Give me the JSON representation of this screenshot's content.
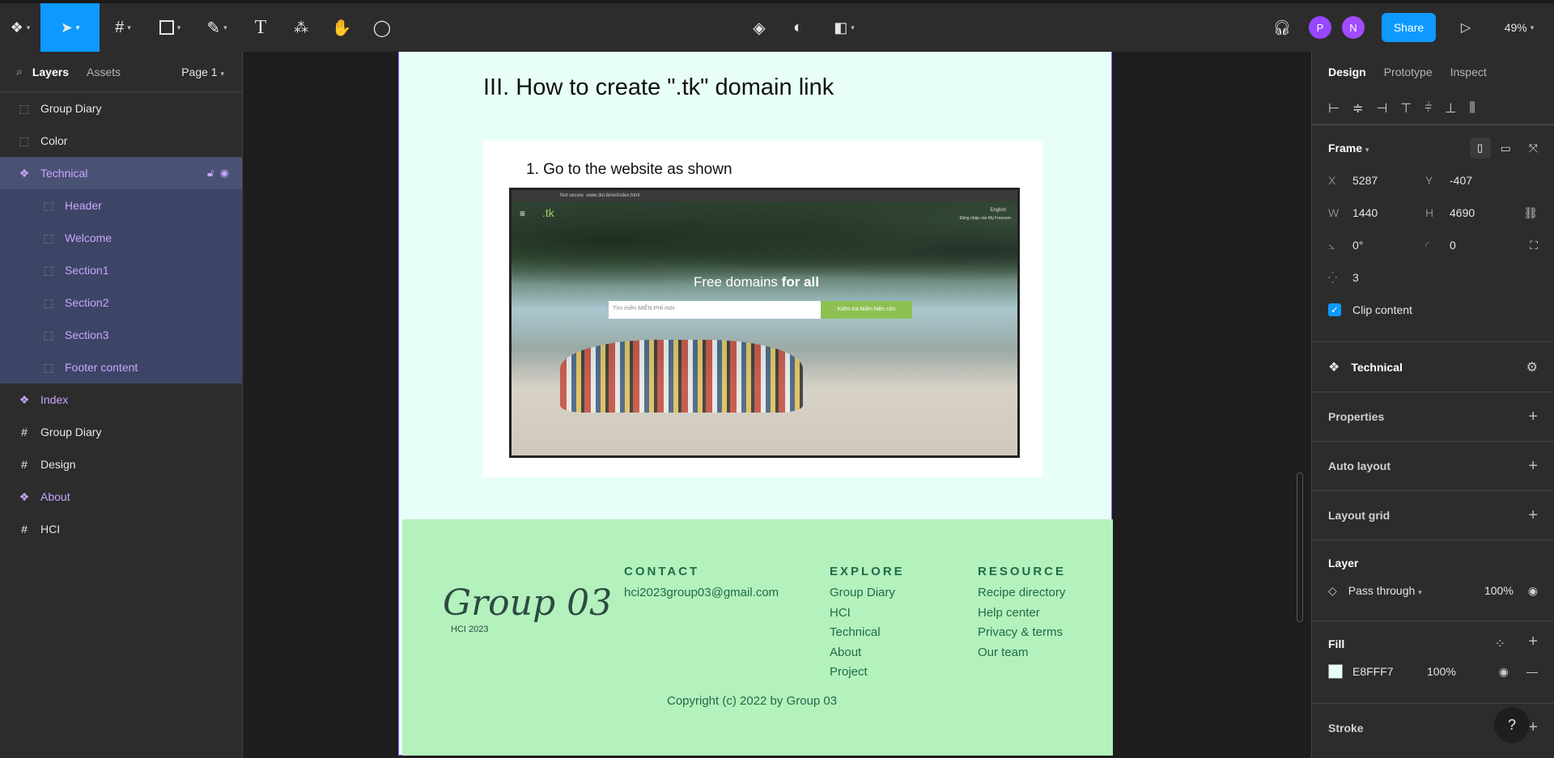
{
  "topbar": {
    "avatars": [
      "P",
      "N"
    ],
    "share_label": "Share",
    "zoom": "49%"
  },
  "left_panel": {
    "tabs": [
      "Layers",
      "Assets"
    ],
    "page_selector": "Page 1",
    "layers": [
      {
        "label": "Group Diary"
      },
      {
        "label": "Color"
      },
      {
        "label": "Technical"
      },
      {
        "label": "Header"
      },
      {
        "label": "Welcome"
      },
      {
        "label": "Section1"
      },
      {
        "label": "Section2"
      },
      {
        "label": "Section3"
      },
      {
        "label": "Footer content"
      },
      {
        "label": "Index"
      },
      {
        "label": "Group Diary"
      },
      {
        "label": "Design"
      },
      {
        "label": "About"
      },
      {
        "label": "HCI"
      }
    ]
  },
  "artboard": {
    "heading": "III. How to create \".tk\" domain link",
    "step_text": "1. Go to the website as shown",
    "screenshot": {
      "hero_text_light": "Free domains",
      "hero_text_bold": "for all",
      "search_placeholder": "Tìm miền MIỄN PHÍ mới",
      "search_button": "Kiểm tra Miền hiện còn",
      "browser_url": "www.dot.tk/vn/index.html",
      "not_secure": "Not secure",
      "lang": "English",
      "login": "Đăng nhập vào My Freenom",
      "logo": ".tk"
    },
    "footer": {
      "logo_script": "Group 03",
      "logo_sub": "HCI 2023",
      "contact_heading": "CONTACT",
      "contact_email": "hci2023group03@gmail.com",
      "explore_heading": "EXPLORE",
      "explore_links": [
        "Group Diary",
        "HCI",
        "Technical",
        "About",
        "Project"
      ],
      "resource_heading": "RESOURCE",
      "resource_links": [
        "Recipe directory",
        "Help center",
        "Privacy & terms",
        "Our team"
      ],
      "copyright": "Copyright (c) 2022 by Group 03"
    }
  },
  "right_panel": {
    "tabs": [
      "Design",
      "Prototype",
      "Inspect"
    ],
    "frame": {
      "title": "Frame",
      "x": "5287",
      "y": "-407",
      "w": "1440",
      "h": "4690",
      "rotation": "0°",
      "radius": "0",
      "count": "3",
      "clip_label": "Clip content"
    },
    "component": {
      "name": "Technical"
    },
    "sections": [
      "Properties",
      "Auto layout",
      "Layout grid"
    ],
    "layer": {
      "title": "Layer",
      "blend": "Pass through",
      "opacity": "100%"
    },
    "fill": {
      "title": "Fill",
      "hex": "E8FFF7",
      "opacity": "100%",
      "swatch": "#e8fff7"
    },
    "stroke": {
      "title": "Stroke"
    },
    "help": "?"
  }
}
